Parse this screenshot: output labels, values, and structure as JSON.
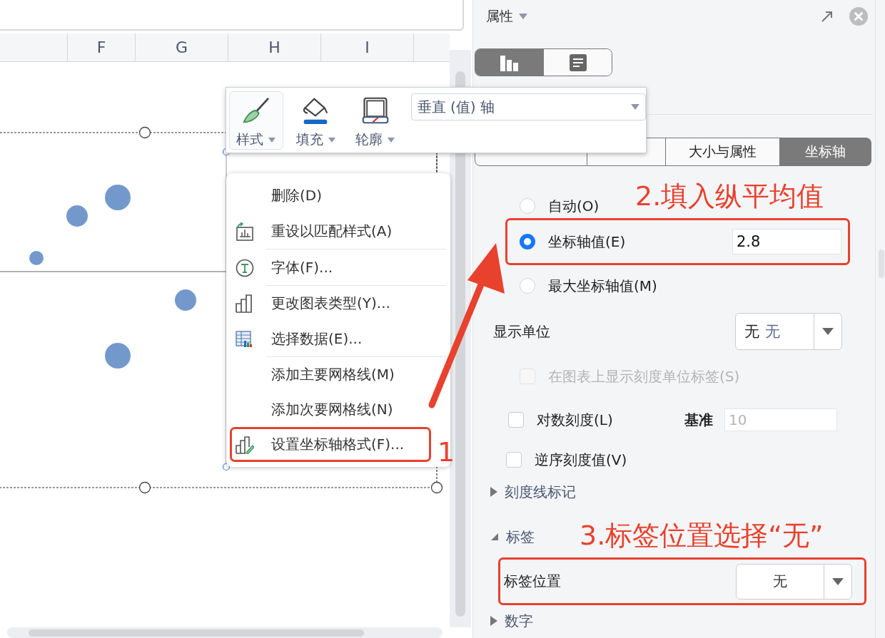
{
  "spreadsheet": {
    "columns": [
      "F",
      "G",
      "H",
      "I"
    ]
  },
  "chart_toolbar": {
    "buttons": [
      {
        "kind": "style",
        "label": "样式",
        "selected": true
      },
      {
        "kind": "fill",
        "label": "填充",
        "selected": false
      },
      {
        "kind": "outline",
        "label": "轮廓",
        "selected": false
      }
    ],
    "element_select": {
      "value": "垂直 (值) 轴"
    }
  },
  "context_menu": {
    "items": [
      {
        "kind": "none",
        "label": "删除(D)",
        "separator_after": false,
        "highlighted": false
      },
      {
        "kind": "reset",
        "label": "重设以匹配样式(A)",
        "separator_after": true,
        "highlighted": false
      },
      {
        "kind": "font",
        "label": "字体(F)...",
        "separator_after": true,
        "highlighted": false
      },
      {
        "kind": "chart_type",
        "label": "更改图表类型(Y)...",
        "separator_after": false,
        "highlighted": false
      },
      {
        "kind": "data",
        "label": "选择数据(E)...",
        "separator_after": true,
        "highlighted": false
      },
      {
        "kind": "none",
        "label": "添加主要网格线(M)",
        "separator_after": false,
        "highlighted": false
      },
      {
        "kind": "none",
        "label": "添加次要网格线(N)",
        "separator_after": false,
        "highlighted": false
      },
      {
        "kind": "format_axis",
        "label": "设置坐标轴格式(F)...",
        "separator_after": false,
        "highlighted": true
      }
    ]
  },
  "properties_panel": {
    "title": "属性",
    "view_toggle": [
      {
        "kind": "chart",
        "selected": true
      },
      {
        "kind": "text",
        "selected": false
      }
    ],
    "tabs": [
      {
        "selected": false
      },
      {
        "selected": false
      },
      {
        "label": "大小与属性",
        "selected": false
      },
      {
        "label": "坐标轴",
        "selected": true
      }
    ],
    "axis_crossing": [
      {
        "label": "自动(O)",
        "selected": false,
        "highlighted": false
      },
      {
        "label": "坐标轴值(E)",
        "selected": true,
        "value": "2.8",
        "highlighted": true
      },
      {
        "label": "最大坐标轴值(M)",
        "selected": false,
        "highlighted": false
      }
    ],
    "display_unit": {
      "label": "显示单位",
      "value": "无",
      "preview": "无"
    },
    "show_unit_label": {
      "label": "在图表上显示刻度单位标签(S)",
      "checked": false,
      "disabled": true
    },
    "log_scale": {
      "label": "对数刻度(L)",
      "checked": false,
      "base_label": "基准",
      "base_value": "10",
      "base_disabled": true
    },
    "reverse_order": {
      "label": "逆序刻度值(V)",
      "checked": false
    },
    "sections": [
      {
        "title": "刻度线标记",
        "expanded": false
      },
      {
        "title": "标签",
        "expanded": true,
        "fields": [
          {
            "label": "标签位置",
            "value": "无",
            "highlighted": true
          }
        ]
      },
      {
        "title": "数字",
        "expanded": false
      }
    ]
  },
  "callouts": [
    {
      "text": "1"
    },
    {
      "text": "2.填入纵平均值"
    },
    {
      "text": "3.标签位置选择“无”"
    }
  ]
}
